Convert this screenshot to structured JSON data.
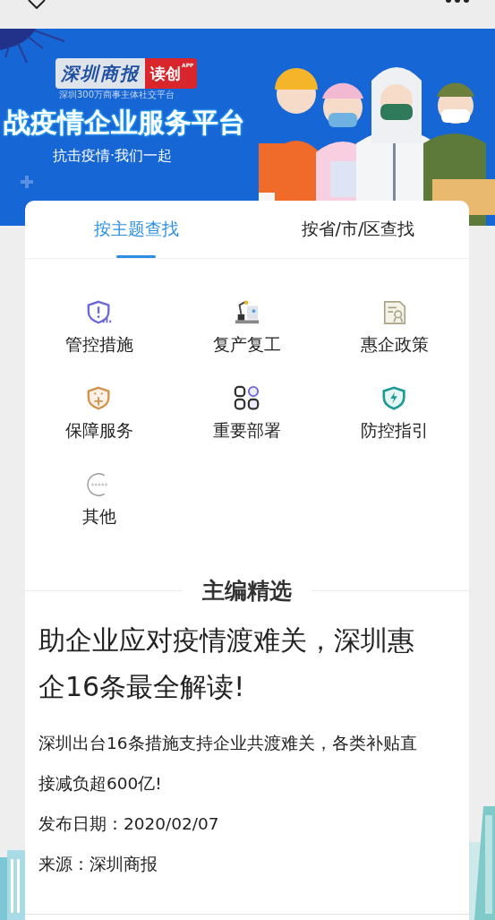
{
  "banner": {
    "logo": {
      "name": "深圳商报",
      "badge": "读创",
      "badge_note": "APP",
      "tagline": "深圳300万商事主体社交平台"
    },
    "title": "战疫情企业服务平台",
    "subtitle": "抗击疫情·我们一起"
  },
  "tabs": [
    {
      "label": "按主题查找",
      "selected": true
    },
    {
      "label": "按省/市/区查找",
      "selected": false
    }
  ],
  "categories": [
    {
      "label": "管控措施"
    },
    {
      "label": "复产复工"
    },
    {
      "label": "惠企政策"
    },
    {
      "label": "保障服务"
    },
    {
      "label": "重要部署"
    },
    {
      "label": "防控指引"
    },
    {
      "label": "其他"
    }
  ],
  "section_title": "主编精选",
  "article": {
    "title": "助企业应对疫情渡难关，深圳惠企16条最全解读!",
    "summary": "深圳出台16条措施支持企业共渡难关，各类补贴直接减负超600亿!",
    "date": "发布日期：2020/02/07",
    "source": "来源：深圳商报"
  }
}
